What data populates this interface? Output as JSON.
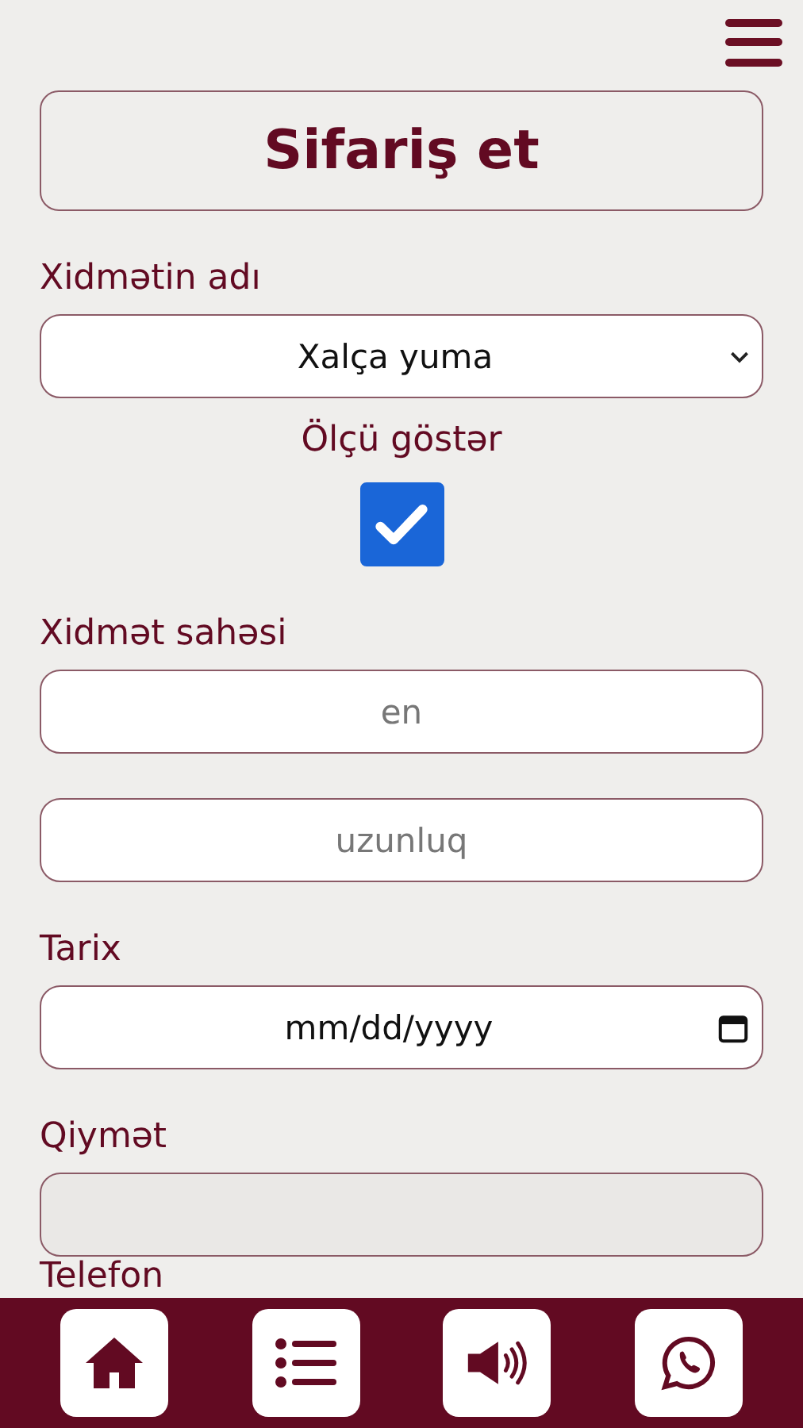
{
  "title": "Sifariş et",
  "fields": [
    {
      "kind": "select",
      "label": "Xidmətin adı",
      "value": "Xalça yuma"
    },
    {
      "kind": "checkbox",
      "caption": "Ölçü göstər",
      "checked": true
    },
    {
      "kind": "inputs",
      "label": "Xidmət sahəsi",
      "placeholders": [
        "en",
        "uzunluq"
      ]
    },
    {
      "kind": "date",
      "label": "Tarix",
      "placeholder": "mm/dd/yyyy"
    },
    {
      "kind": "readonly",
      "label": "Qiymət"
    },
    {
      "kind": "label",
      "label": "Telefon"
    }
  ]
}
